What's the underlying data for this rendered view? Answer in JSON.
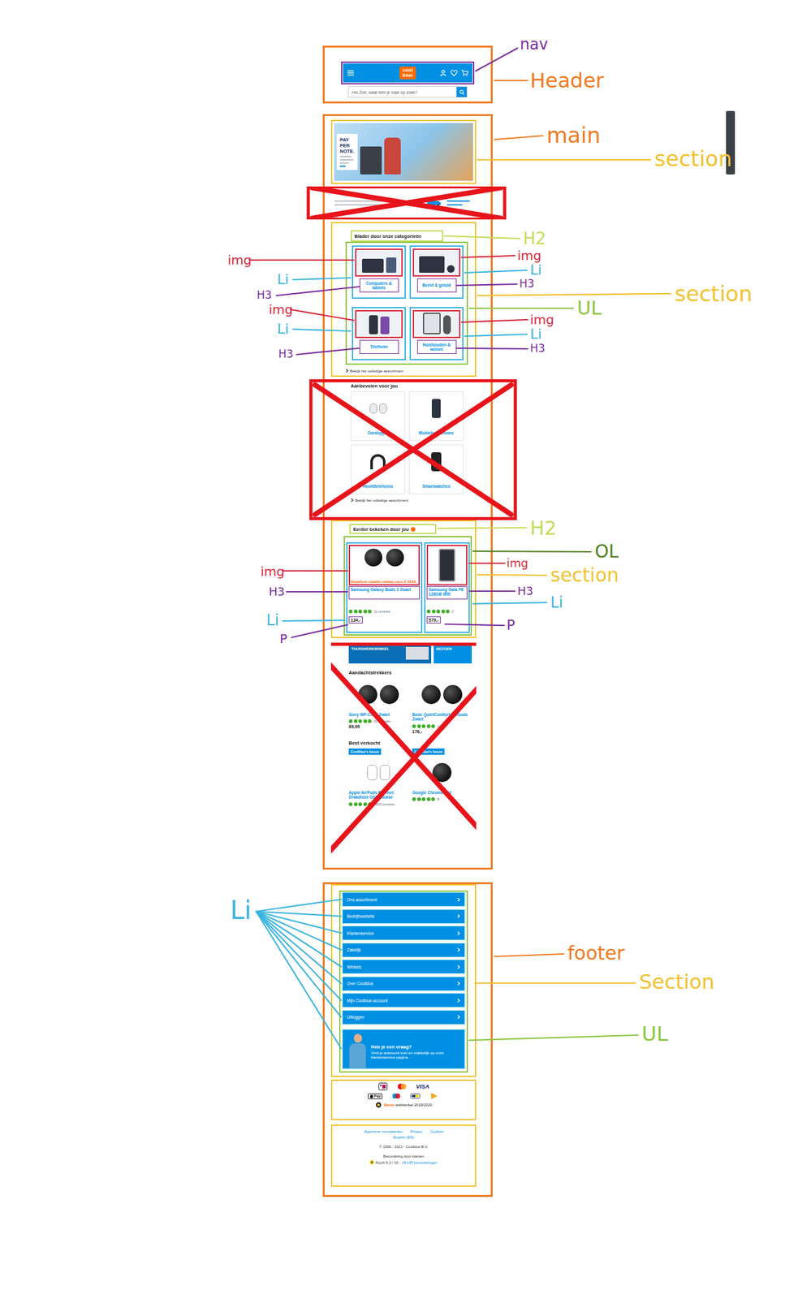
{
  "header": {
    "logo_top": "cool",
    "logo_bottom": "blue",
    "search_placeholder": "Hoi Zoë, waar ben je naar op zoek?"
  },
  "banner": {
    "title": "PAY PER NOTE.",
    "excluded": false
  },
  "delivery_strip": {
    "excluded": true
  },
  "categories": {
    "title": "Blader door onze categorieën",
    "items": [
      {
        "name": "Computers & tablets"
      },
      {
        "name": "Beeld & geluid"
      },
      {
        "name": "Telefonie"
      },
      {
        "name": "Huishouden & wonen"
      }
    ],
    "link": "Bekijk het volledige assortiment",
    "excluded": false
  },
  "recommended": {
    "title": "Aanbevolen voor jou",
    "items": [
      {
        "name": "Oordopjes"
      },
      {
        "name": "Mobiele telefoons"
      },
      {
        "name": "Hoofdtelefoons"
      },
      {
        "name": "Smartwatches"
      }
    ],
    "link": "Bekijk het volledige assortiment",
    "excluded": true
  },
  "recently_viewed": {
    "title": "Eerder bekeken door jou",
    "excluded": false,
    "items": [
      {
        "promo": "Draadloze oplader cadeau t.w.v. € 39,99",
        "name": "Samsung Galaxy Buds 2 Zwart",
        "stars": 5,
        "reviews": "11 reviews",
        "price": "134,-"
      },
      {
        "promo": "",
        "name": "Samsung Gala FE 128GB Wifi",
        "stars": 5,
        "reviews": "2",
        "price": "579,-"
      }
    ]
  },
  "eye_catchers": {
    "excluded": true,
    "promos": [
      "THUISWERKWINKEL",
      "BEZOEK"
    ],
    "title": "Aandachtstrekkers",
    "items": [
      {
        "name": "Sony WF-C500 Zwart",
        "stars": 5,
        "reviews": "31 reviews",
        "price": "89,99"
      },
      {
        "name": "Bose QuietComfort Earbuds Zwart",
        "stars": 5,
        "reviews": "12",
        "price": "176,-"
      }
    ],
    "best_title": "Best verkocht",
    "best_items": [
      {
        "badge": "Coolblue's keuze",
        "name": "Apple AirPods Pro met Draadloze Oplaadcase",
        "stars": 5,
        "reviews": "1933 reviews"
      },
      {
        "badge": "Coolblue's keuze",
        "name": "Google Chromecast",
        "stars": 5,
        "reviews": "8"
      }
    ]
  },
  "footer": {
    "menu": [
      "Ons assortiment",
      "Bedrijfswebsite",
      "Klantenservice",
      "Zakelijk",
      "Winkels",
      "Over Coolblue",
      "Mijn Coolblue-account",
      "Uitloggen"
    ],
    "help": {
      "title": "Heb je een vraag?",
      "text": "Vind je antwoord snel en makkelijk op onze klantenservice pagina."
    },
    "payments": {
      "visa": "VISA",
      "apple_pay": "Pay"
    },
    "award": {
      "highlight": "Beste",
      "rest": "webwinkel 2019/2020"
    },
    "legal": {
      "links": [
        "Algemene voorwaarden",
        "Privacy",
        "Cookies"
      ],
      "language": "English (EN)",
      "copyright": "© 1999 - 2021 · Coolblue B.V.",
      "rating_label": "Beoordeling door klanten",
      "rating_prefix": "Kiyoh 9.2 / 10 -",
      "rating_link": "18.145 beoordelingen"
    }
  },
  "annotations": [
    {
      "label": "nav",
      "color": "#7a2d9c"
    },
    {
      "label": "Header",
      "color": "#f07b22"
    },
    {
      "label": "main",
      "color": "#f07b22"
    },
    {
      "label": "section",
      "color": "#f2c230"
    },
    {
      "label": "H2",
      "color": "#c5dc5c"
    },
    {
      "label": "img",
      "color": "#d8283c"
    },
    {
      "label": "Li",
      "color": "#3ab4e0"
    },
    {
      "label": "H3",
      "color": "#7a2d9c"
    },
    {
      "label": "section",
      "color": "#f2c230"
    },
    {
      "label": "UL",
      "color": "#8cc63f"
    },
    {
      "label": "img",
      "color": "#d8283c"
    },
    {
      "label": "Li",
      "color": "#3ab4e0"
    },
    {
      "label": "H3",
      "color": "#7a2d9c"
    },
    {
      "label": "img",
      "color": "#d8283c"
    },
    {
      "label": "Li",
      "color": "#3ab4e0"
    },
    {
      "label": "H3",
      "color": "#7a2d9c"
    },
    {
      "label": "img",
      "color": "#d8283c"
    },
    {
      "label": "Li",
      "color": "#3ab4e0"
    },
    {
      "label": "H3",
      "color": "#7a2d9c"
    },
    {
      "label": "H2",
      "color": "#c5dc5c"
    },
    {
      "label": "OL",
      "color": "#4e7f1e"
    },
    {
      "label": "img",
      "color": "#d8283c"
    },
    {
      "label": "section",
      "color": "#f2c230"
    },
    {
      "label": "H3",
      "color": "#7a2d9c"
    },
    {
      "label": "Li",
      "color": "#3ab4e0"
    },
    {
      "label": "P",
      "color": "#7a2d9c"
    },
    {
      "label": "img",
      "color": "#d8283c"
    },
    {
      "label": "H3",
      "color": "#7a2d9c"
    },
    {
      "label": "Li",
      "color": "#3ab4e0"
    },
    {
      "label": "P",
      "color": "#7a2d9c"
    },
    {
      "label": "Li",
      "color": "#3ab4e0"
    },
    {
      "label": "footer",
      "color": "#f07b22"
    },
    {
      "label": "Section",
      "color": "#f2c230"
    },
    {
      "label": "UL",
      "color": "#8cc63f"
    }
  ]
}
